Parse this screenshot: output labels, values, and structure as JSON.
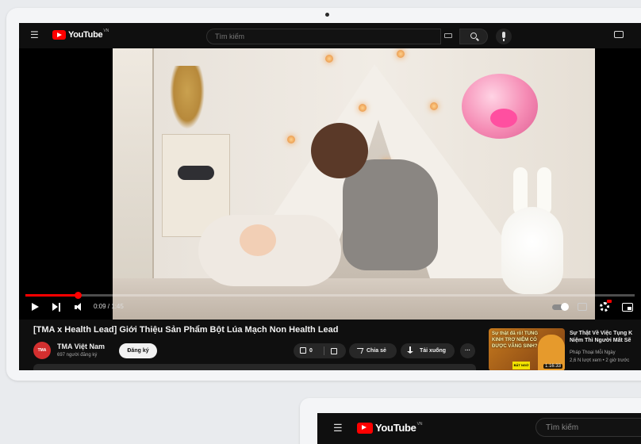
{
  "topbar": {
    "logo_text": "YouTube",
    "region": "VN",
    "search_placeholder": "Tìm kiếm"
  },
  "player": {
    "time": "0:09 / 1:45",
    "progress_fraction": 0.086
  },
  "video": {
    "title": "[TMA x Health Lead] Giới Thiệu Sản Phẩm Bột Lúa Mạch Non Health Lead",
    "channel_name": "TMA Việt Nam",
    "channel_avatar_text": "TMA",
    "subscribers": "697 người đăng ký",
    "subscribe_label": "Đăng ký",
    "like_count": "0",
    "share_label": "Chia sẻ",
    "download_label": "Tải xuống",
    "more_label": "···"
  },
  "up_next": {
    "thumb_text": "Sự thật đã rõ! TUNG KINH TRỢ NIỆM CÓ ĐƯỢC VÃNG SINH?",
    "thumb_badge": "BẤT NGỜ",
    "duration": "1:16:33",
    "title_line1": "Sự Thật Về Việc Tụng K",
    "title_line2": "Niệm Thì Người Mất Sẽ",
    "channel": "Pháp Thoại Mỗi Ngày",
    "meta": "2,6 N lượt xem • 2 giờ trước"
  },
  "second_screen": {
    "logo_text": "YouTube",
    "region": "VN",
    "search_placeholder": "Tìm kiếm"
  },
  "icons": [
    "menu-icon",
    "youtube-logo-icon",
    "keyboard-icon",
    "search-icon",
    "mic-icon",
    "create-icon",
    "play-icon",
    "next-icon",
    "volume-icon",
    "autoplay-toggle-icon",
    "captions-icon",
    "settings-icon",
    "miniplayer-icon",
    "like-icon",
    "dislike-icon",
    "share-icon",
    "download-icon"
  ],
  "colors": {
    "brand_red": "#ff0000",
    "page_bg": "#0f0f0f",
    "pill_bg": "#272727"
  }
}
